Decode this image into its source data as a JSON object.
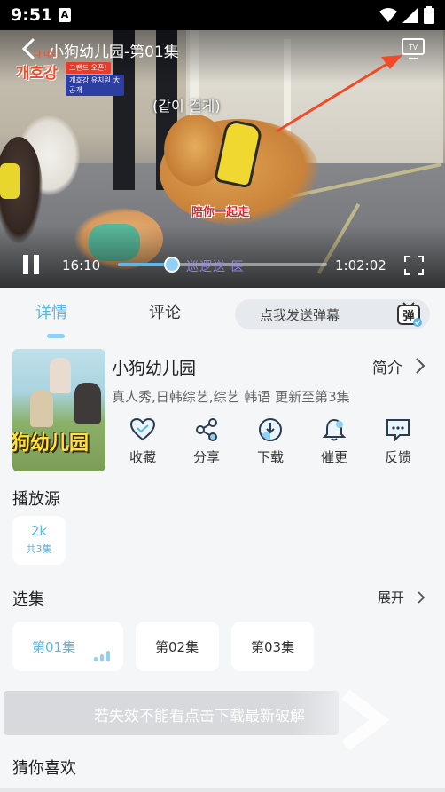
{
  "status_bar": {
    "time": "9:51",
    "notif_badge": "A"
  },
  "video": {
    "title": "小狗幼儿园-第01集",
    "korean_subtitle": "(같이 걸게)",
    "chinese_subtitle": "陪你一起走",
    "logo_text": "개호강",
    "logo_small": "나 대결",
    "logo_tag1": "그랜드 오픈!",
    "logo_tag2": "개호강 유치원 大 공개",
    "current_time": "16:10",
    "total_time": "1:02:02",
    "progress_fraction": 0.26,
    "watermark": "巡逻送 医",
    "accent": "#5ab6e6"
  },
  "tabs": {
    "details": "详情",
    "comments": "评论",
    "danmu_placeholder": "点我发送弹幕",
    "danmu_icon_text": "弹"
  },
  "show": {
    "title": "小狗幼儿园",
    "intro_label": "简介",
    "meta": "真人秀,日韩综艺,综艺 韩语 更新至第3集",
    "poster_text": "狗幼儿园"
  },
  "actions": [
    {
      "label": "收藏",
      "icon": "heart-icon"
    },
    {
      "label": "分享",
      "icon": "share-icon"
    },
    {
      "label": "下载",
      "icon": "download-icon"
    },
    {
      "label": "催更",
      "icon": "bell-icon"
    },
    {
      "label": "反馈",
      "icon": "feedback-icon"
    }
  ],
  "source": {
    "section_title": "播放源",
    "name": "2k",
    "count": "共3集"
  },
  "episodes": {
    "section_title": "选集",
    "expand_label": "展开",
    "items": [
      "第01集",
      "第02集",
      "第03集"
    ]
  },
  "banner": {
    "text": "若失效不能看点击下载最新破解"
  },
  "guess": {
    "section_title": "猜你喜欢"
  }
}
